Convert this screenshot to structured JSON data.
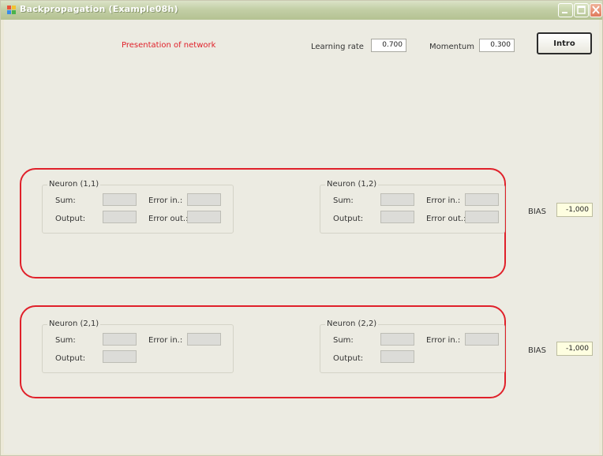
{
  "window": {
    "title": "Backpropagation (Example08h)"
  },
  "header": {
    "presentation_title": "Presentation of network",
    "learning_rate_label": "Learning rate",
    "learning_rate_value": "0.700",
    "momentum_label": "Momentum",
    "momentum_value": "0.300",
    "intro_label": "Intro"
  },
  "layer1": {
    "neurons": [
      {
        "title": "Neuron (1,1)",
        "sum_label": "Sum:",
        "output_label": "Output:",
        "error_in_label": "Error in.:",
        "error_out_label": "Error out.:"
      },
      {
        "title": "Neuron (1,2)",
        "sum_label": "Sum:",
        "output_label": "Output:",
        "error_in_label": "Error in.:",
        "error_out_label": "Error out.:"
      }
    ],
    "bias_label": "BIAS",
    "bias_value": "-1,000"
  },
  "layer2": {
    "neurons": [
      {
        "title": "Neuron (2,1)",
        "sum_label": "Sum:",
        "output_label": "Output:",
        "error_in_label": "Error in.:"
      },
      {
        "title": "Neuron (2,2)",
        "sum_label": "Sum:",
        "output_label": "Output:",
        "error_in_label": "Error in.:"
      }
    ],
    "bias_label": "BIAS",
    "bias_value": "-1,000"
  },
  "colors": {
    "highlight": "#e0202a",
    "title_red": "#e0202a",
    "bias_field": "#fefee0",
    "window_bg": "#ecebe2"
  }
}
